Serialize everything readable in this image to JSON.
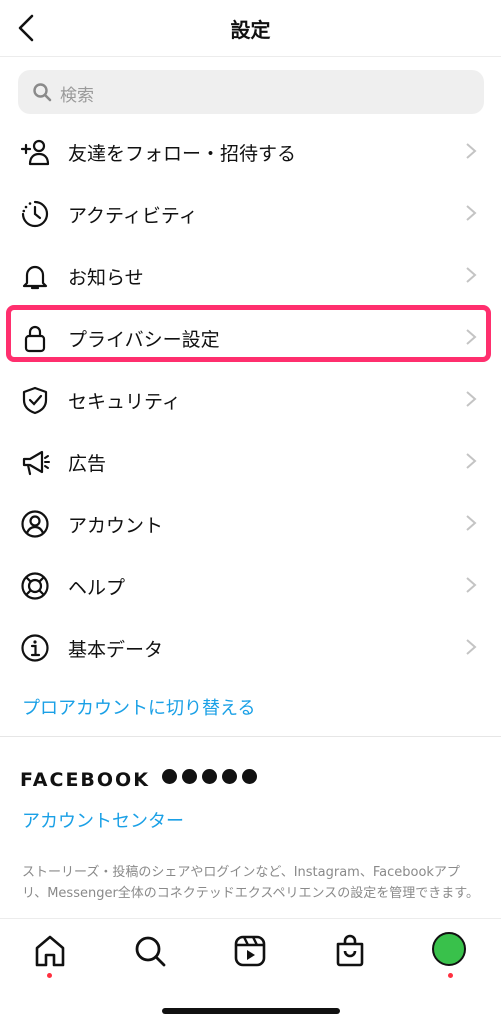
{
  "header": {
    "title": "設定"
  },
  "search": {
    "placeholder": "検索"
  },
  "menu": [
    {
      "label": "友達をフォロー・招待する",
      "icon": "add-person-icon"
    },
    {
      "label": "アクティビティ",
      "icon": "activity-icon"
    },
    {
      "label": "お知らせ",
      "icon": "bell-icon"
    },
    {
      "label": "プライバシー設定",
      "icon": "lock-icon"
    },
    {
      "label": "セキュリティ",
      "icon": "shield-icon"
    },
    {
      "label": "広告",
      "icon": "megaphone-icon"
    },
    {
      "label": "アカウント",
      "icon": "account-icon"
    },
    {
      "label": "ヘルプ",
      "icon": "lifebuoy-icon"
    },
    {
      "label": "基本データ",
      "icon": "info-icon"
    }
  ],
  "pro_link": "プロアカウントに切り替える",
  "facebook": {
    "wordmark": "FACEBOOK",
    "account_center": "アカウントセンター",
    "description": "ストーリーズ・投稿のシェアやログインなど、Instagram、Facebookアプリ、Messenger全体のコネクテッドエクスペリエンスの設定を管理できます。"
  },
  "colors": {
    "highlight": "#ff2f6e",
    "link": "#1aa0e6",
    "badge": "#ff3040"
  }
}
